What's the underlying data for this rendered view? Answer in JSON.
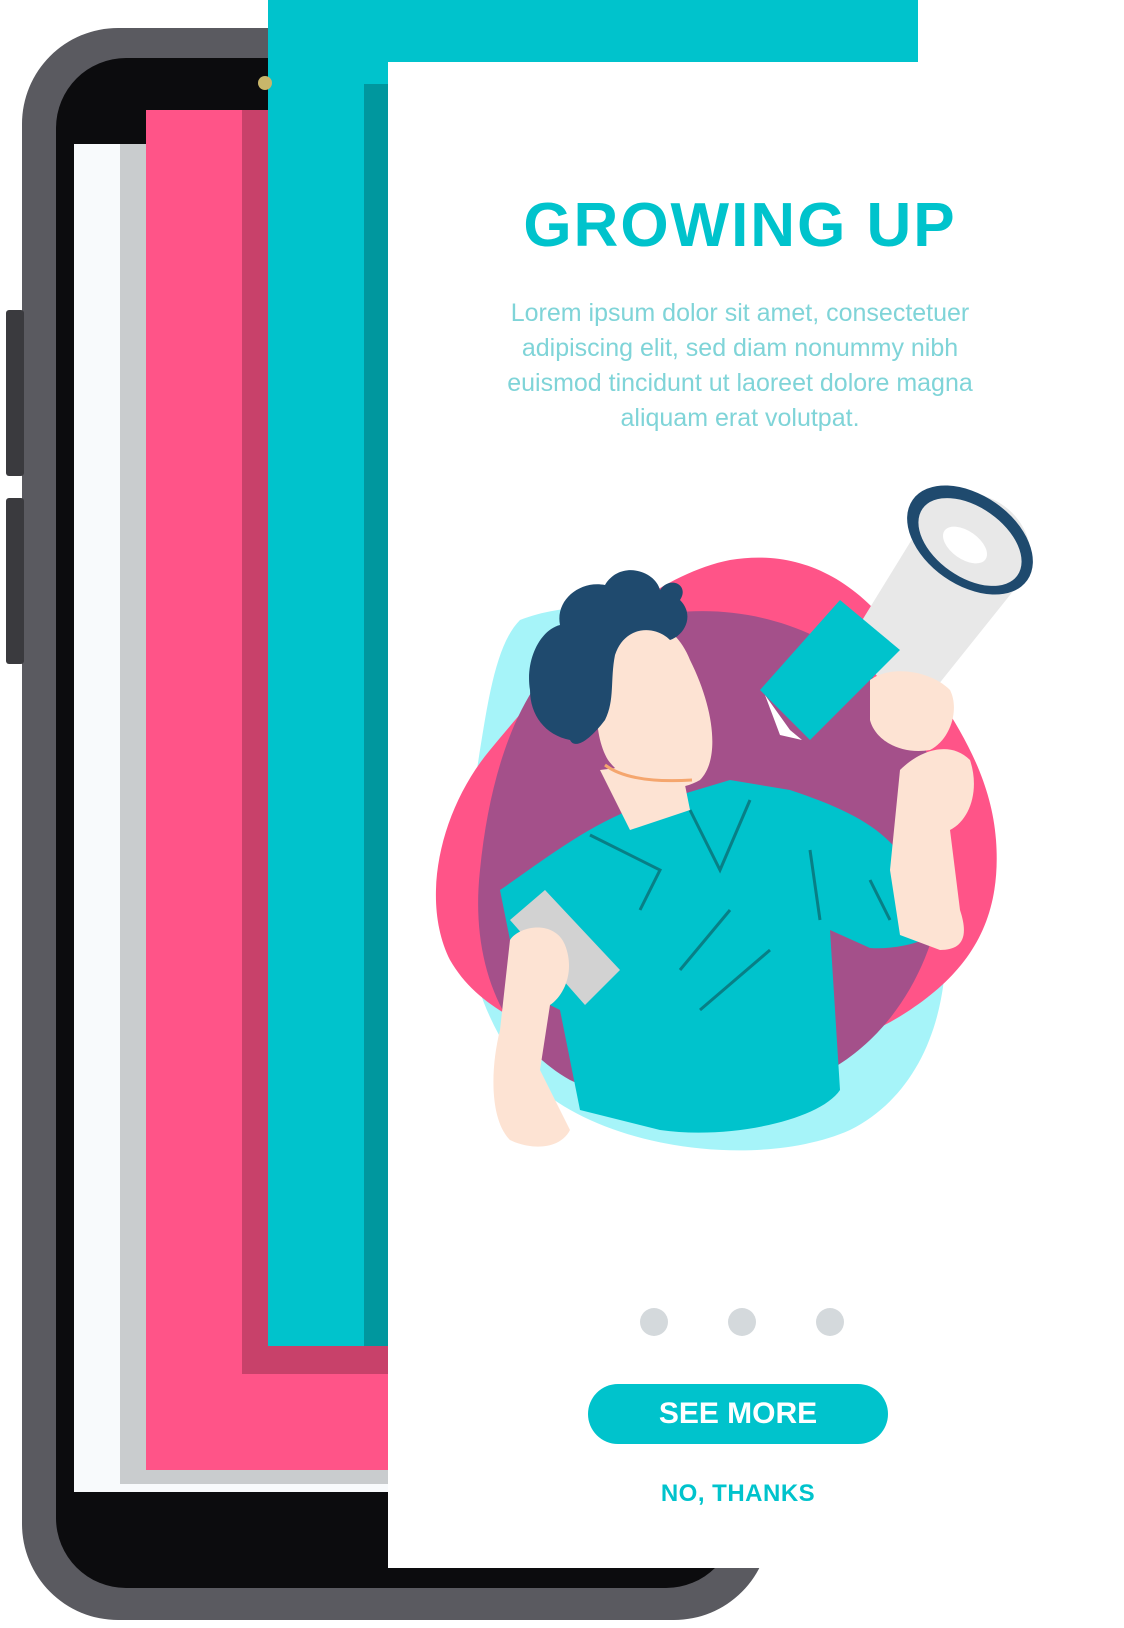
{
  "screen": {
    "title": "GROWING UP",
    "description": "Lorem ipsum dolor sit amet, consectetuer adipiscing elit, sed diam nonummy nibh euismod tincidunt ut laoreet dolore magna aliquam erat volutpat.",
    "illustration": "man-with-megaphone-illustration",
    "pagination": {
      "total": 3
    },
    "primary_action": "SEE MORE",
    "secondary_action": "NO, THANKS"
  },
  "colors": {
    "accent": "#00c3cc",
    "pink": "#ff5488",
    "purple": "#a4508a",
    "light_cyan": "#a6f4f9",
    "dot_inactive": "#d4d9dc"
  }
}
